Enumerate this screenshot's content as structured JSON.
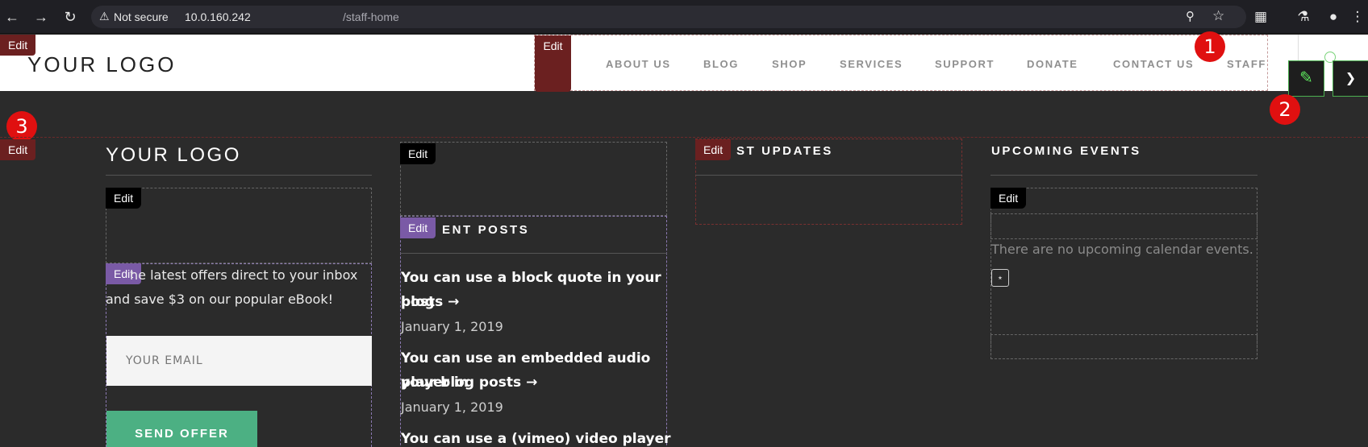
{
  "browser": {
    "security_label": "Not secure",
    "url_host": "10.0.160.242",
    "url_path": "/staff-home"
  },
  "header": {
    "logo": "YOUR LOGO",
    "edit_label": "Edit",
    "nav_edit_label": "Edit",
    "nav": [
      "ABOUT US",
      "BLOG",
      "SHOP",
      "SERVICES",
      "SUPPORT",
      "DONATE",
      "CONTACT US",
      "STAFF"
    ]
  },
  "markers": [
    "1",
    "2",
    "3"
  ],
  "footer": {
    "row_edit_label": "Edit",
    "col1": {
      "logo": "YOUR LOGO",
      "edit_label": "Edit",
      "text_edit_label": "Edit",
      "offer_text_line1": "he latest offers direct to your inbox",
      "offer_text_line2": "and save $3 on our popular eBook!",
      "email_placeholder": "YOUR EMAIL",
      "send_label": "SEND OFFER"
    },
    "col2": {
      "edit_label": "Edit",
      "posts_edit_label": "Edit",
      "heading": "ENT POSTS",
      "posts": [
        {
          "title_line1": "You can use a block quote in your blog",
          "title_line2": "posts",
          "date": "January 1, 2019"
        },
        {
          "title_line1": "You can use an embedded audio player in",
          "title_line2": "your blog posts",
          "date": "January 1, 2019"
        },
        {
          "title_line1": "You can use a (vimeo) video player in your",
          "title_line2": "",
          "date": ""
        }
      ]
    },
    "col3": {
      "edit_label": "Edit",
      "heading": "ST UPDATES"
    },
    "col4": {
      "heading": "UPCOMING EVENTS",
      "edit_label": "Edit",
      "no_events": "There are no upcoming calendar events."
    }
  }
}
